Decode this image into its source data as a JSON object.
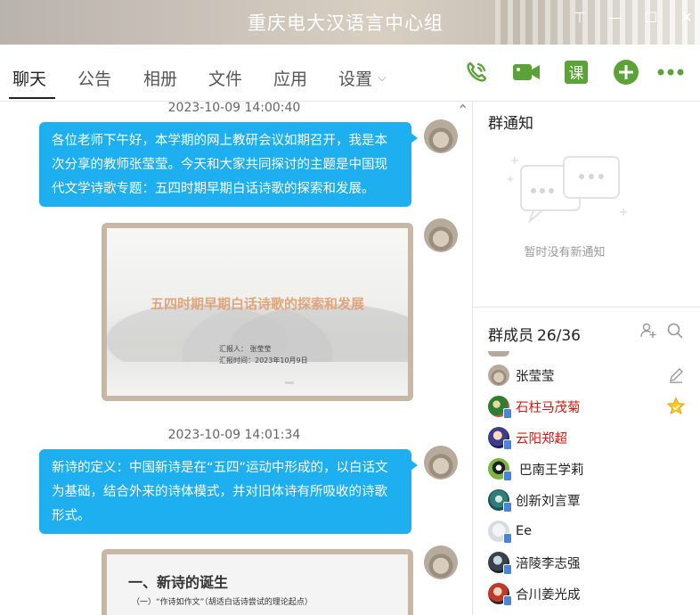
{
  "window": {
    "title": "重庆电大汉语言中心组"
  },
  "tabs": [
    {
      "label": "聊天",
      "active": true
    },
    {
      "label": "公告",
      "active": false
    },
    {
      "label": "相册",
      "active": false
    },
    {
      "label": "文件",
      "active": false
    },
    {
      "label": "应用",
      "active": false
    },
    {
      "label": "设置",
      "active": false
    }
  ],
  "toolbar": {
    "icons": [
      "phone-call-icon",
      "video-call-icon",
      "course-icon",
      "add-icon",
      "more-icon"
    ],
    "course_label": "课",
    "accent": "#5ba339"
  },
  "chat": {
    "accent": "#1daff0",
    "messages": [
      {
        "timestamp": "2023-10-09 14:00:40",
        "text": "各位老师下午好，本学期的网上教研会议如期召开，我是本次分享的教师张莹莹。今天和大家共同探讨的主题是中国现代文学诗歌专题：五四时期早期白话诗歌的探索和发展。"
      },
      {
        "slide": {
          "title": "五四时期早期白话诗歌的探索和发展",
          "reporter": "汇报人：  张莹莹",
          "date": "汇报时间：2023年10月9日"
        }
      },
      {
        "timestamp": "2023-10-09 14:01:34",
        "text": "新诗的定义：中国新诗是在“五四”运动中形成的，以白话文为基础，结合外来的诗体模式，并对旧体诗有所吸收的诗歌形式。"
      },
      {
        "slide": {
          "heading": "一、新诗的诞生",
          "subheading": "（一）“作诗如作文”（胡适白话诗尝试的理论起点）"
        }
      }
    ]
  },
  "notice": {
    "title": "群通知",
    "empty_text": "暂时没有新通知"
  },
  "members": {
    "title": "群成员",
    "count": "26/36",
    "list": [
      {
        "name": "张莹莹",
        "red": false,
        "action": "edit-icon"
      },
      {
        "name": "石柱马茂菊",
        "red": true,
        "action": "star-badge-icon"
      },
      {
        "name": "云阳郑超",
        "red": true,
        "action": ""
      },
      {
        "name": "巴南王学莉",
        "red": false,
        "action": ""
      },
      {
        "name": "创新刘言覃",
        "red": false,
        "action": ""
      },
      {
        "name": "Ee",
        "red": false,
        "action": ""
      },
      {
        "name": "涪陵李志强",
        "red": false,
        "action": ""
      },
      {
        "name": "合川姜光成",
        "red": false,
        "action": ""
      }
    ]
  }
}
